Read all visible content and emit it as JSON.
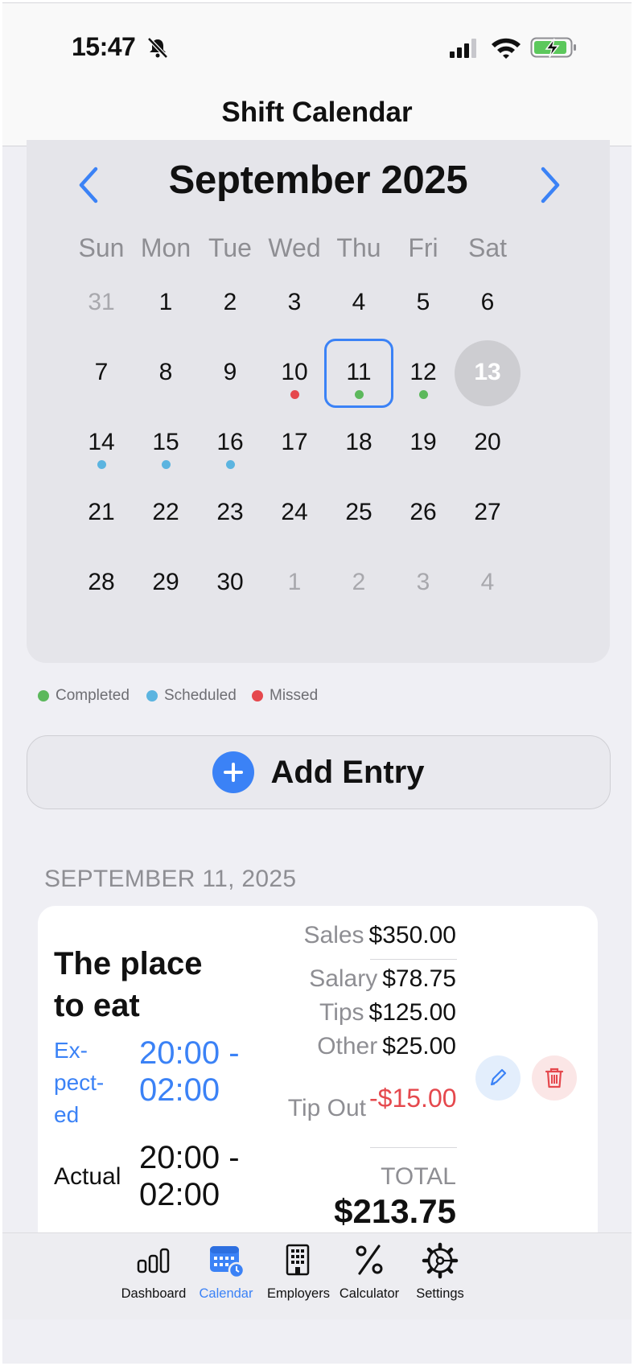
{
  "status_bar": {
    "time": "15:47"
  },
  "header": {
    "title": "Shift Calendar"
  },
  "calendar": {
    "month_title": "September 2025",
    "weekdays": [
      "Sun",
      "Mon",
      "Tue",
      "Wed",
      "Thu",
      "Fri",
      "Sat"
    ],
    "weeks": [
      [
        {
          "d": "31",
          "m": true
        },
        {
          "d": "1"
        },
        {
          "d": "2"
        },
        {
          "d": "3"
        },
        {
          "d": "4"
        },
        {
          "d": "5"
        },
        {
          "d": "6"
        }
      ],
      [
        {
          "d": "7"
        },
        {
          "d": "8"
        },
        {
          "d": "9"
        },
        {
          "d": "10",
          "status": "missed"
        },
        {
          "d": "11",
          "status": "completed",
          "selected": true
        },
        {
          "d": "12",
          "status": "completed"
        },
        {
          "d": "13",
          "today": true
        }
      ],
      [
        {
          "d": "14",
          "status": "scheduled"
        },
        {
          "d": "15",
          "status": "scheduled"
        },
        {
          "d": "16",
          "status": "scheduled"
        },
        {
          "d": "17"
        },
        {
          "d": "18"
        },
        {
          "d": "19"
        },
        {
          "d": "20"
        }
      ],
      [
        {
          "d": "21"
        },
        {
          "d": "22"
        },
        {
          "d": "23"
        },
        {
          "d": "24"
        },
        {
          "d": "25"
        },
        {
          "d": "26"
        },
        {
          "d": "27"
        }
      ],
      [
        {
          "d": "28"
        },
        {
          "d": "29"
        },
        {
          "d": "30"
        },
        {
          "d": "1",
          "m": true
        },
        {
          "d": "2",
          "m": true
        },
        {
          "d": "3",
          "m": true
        },
        {
          "d": "4",
          "m": true
        }
      ]
    ]
  },
  "legend": [
    {
      "label": "Completed",
      "color": "#5cb85c"
    },
    {
      "label": "Scheduled",
      "color": "#5bb4e0"
    },
    {
      "label": "Missed",
      "color": "#e5484d"
    }
  ],
  "status_colors": {
    "completed": "#5cb85c",
    "scheduled": "#5bb4e0",
    "missed": "#e5484d",
    "accent": "#3b82f6"
  },
  "add_entry_label": "Add Entry",
  "section_date": "SEPTEMBER 11, 2025",
  "entry": {
    "employer": "The place to eat",
    "expected_label": "Ex-pect-ed",
    "expected_time": "20:00 - 02:00",
    "actual_label": "Actual",
    "actual_time": "20:00 - 02:00",
    "sales_label": "Sales",
    "sales": "$350.00",
    "salary_label": "Salary",
    "salary": "$78.75",
    "tips_label": "Tips",
    "tips": "$125.00",
    "other_label": "Other",
    "other": "$25.00",
    "tipout_label": "Tip Out",
    "tipout": "-$15.00",
    "total_label": "TOTAL",
    "total": "$213.75"
  },
  "tabs": [
    {
      "label": "Dashboard",
      "icon": "dashboard-icon"
    },
    {
      "label": "Calendar",
      "icon": "calendar-icon",
      "active": true
    },
    {
      "label": "Employers",
      "icon": "building-icon"
    },
    {
      "label": "Calculator",
      "icon": "percent-icon"
    },
    {
      "label": "Settings",
      "icon": "gear-icon"
    }
  ]
}
